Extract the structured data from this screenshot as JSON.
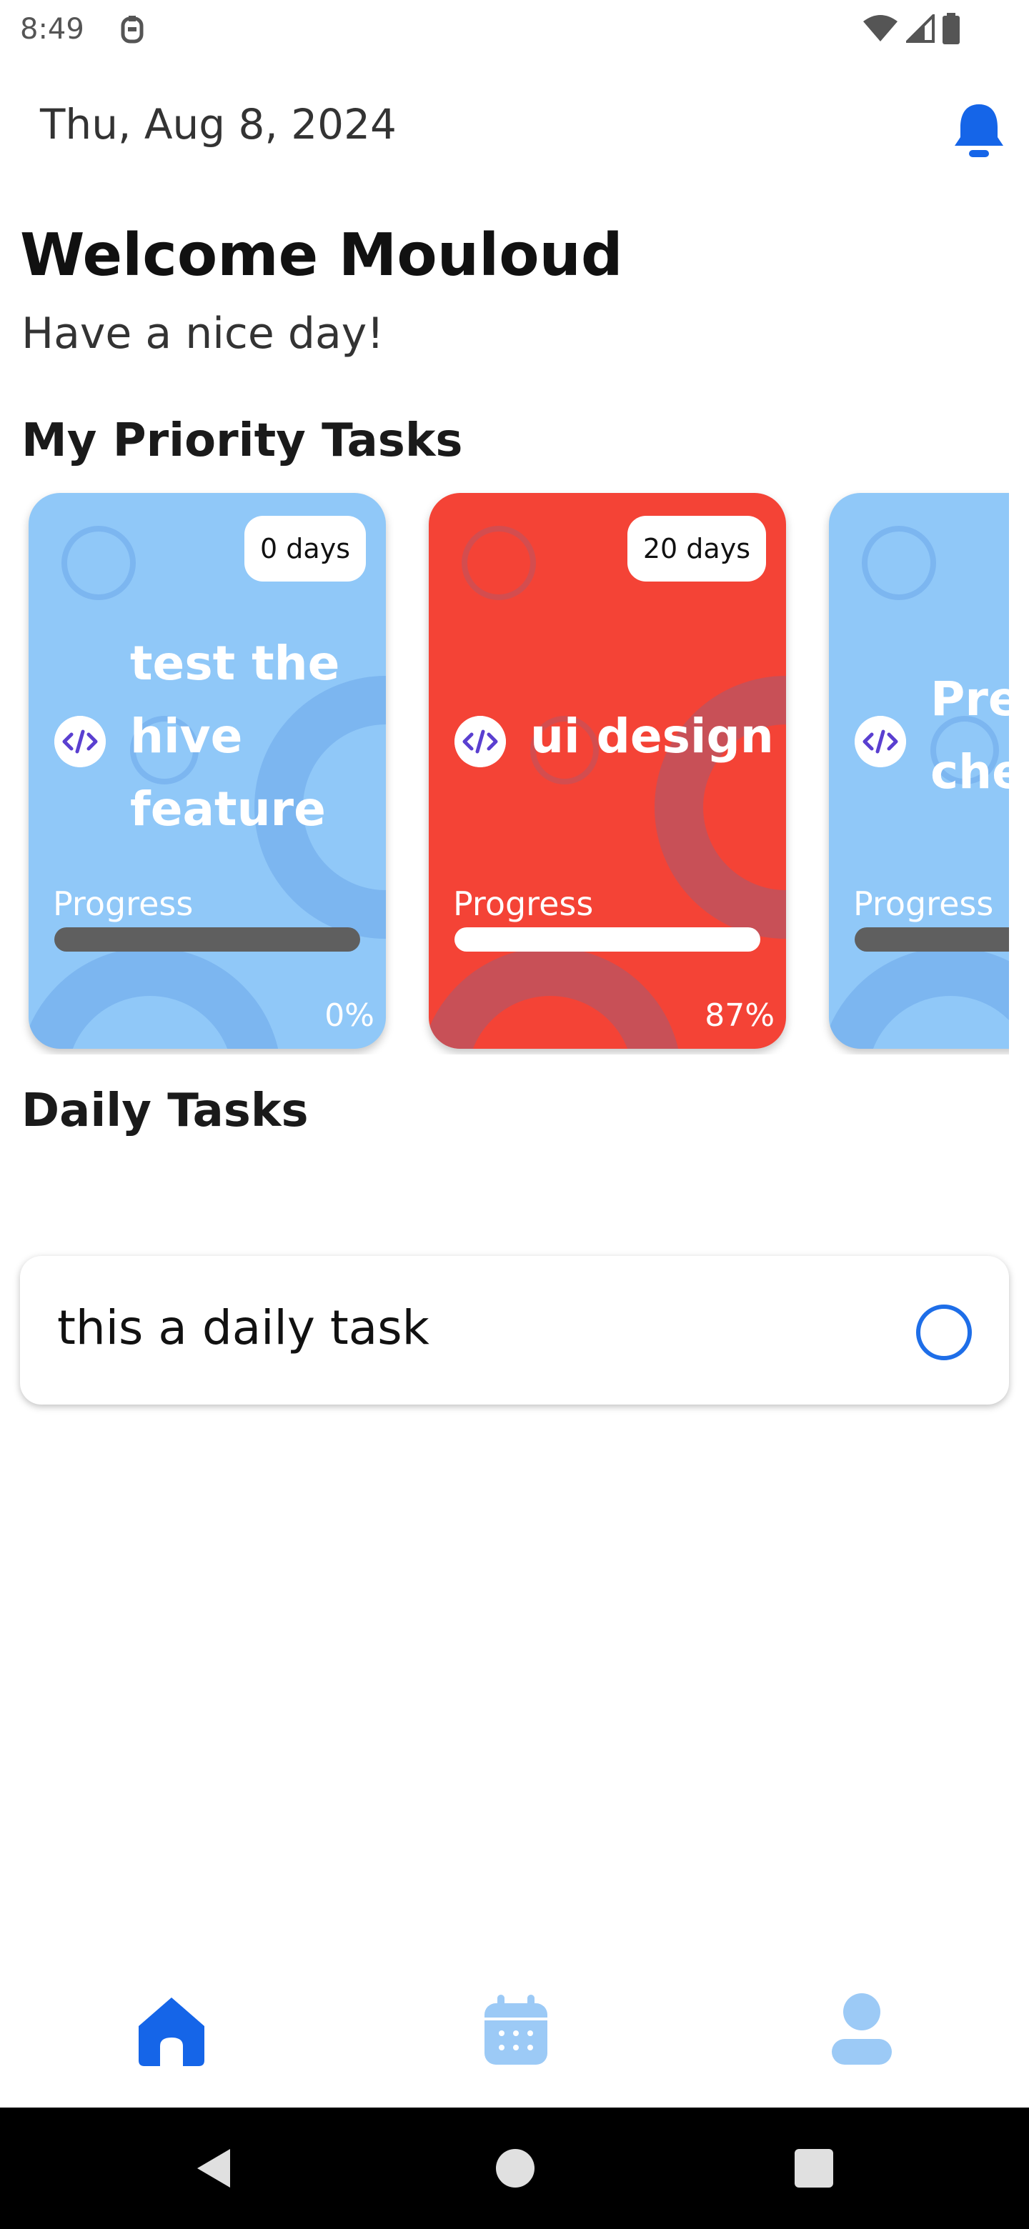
{
  "status_bar": {
    "time": "8:49"
  },
  "header": {
    "date": "Thu, Aug 8, 2024"
  },
  "greeting": {
    "title": "Welcome Mouloud",
    "subtitle": "Have a nice day!"
  },
  "priority": {
    "title": "My Priority Tasks",
    "cards": [
      {
        "days": "0 days",
        "title": "test the hive feature",
        "progress_label": "Progress",
        "percent": "0%",
        "progress": 0,
        "color": "#90c8f8",
        "track_color": "#5f5f5f",
        "fill_color": "#5f5f5f"
      },
      {
        "days": "20 days",
        "title": "ui design",
        "progress_label": "Progress",
        "percent": "87%",
        "progress": 0.87,
        "color": "#f44336",
        "track_color": "#ffffff",
        "fill_color": "#ffffff"
      },
      {
        "days": "",
        "title": "Pre che",
        "progress_label": "Progress",
        "percent": "",
        "progress": 0,
        "color": "#90c8f8",
        "track_color": "#5f5f5f",
        "fill_color": "#5f5f5f"
      }
    ]
  },
  "daily": {
    "title": "Daily Tasks",
    "tasks": [
      {
        "label": "this a daily task"
      }
    ]
  },
  "bottom_nav": {
    "items": [
      "home-icon",
      "calendar-icon",
      "profile-icon"
    ],
    "active_color": "#1565e8",
    "inactive_color": "#9ccaf6"
  },
  "colors": {
    "accent": "#1565e8"
  }
}
